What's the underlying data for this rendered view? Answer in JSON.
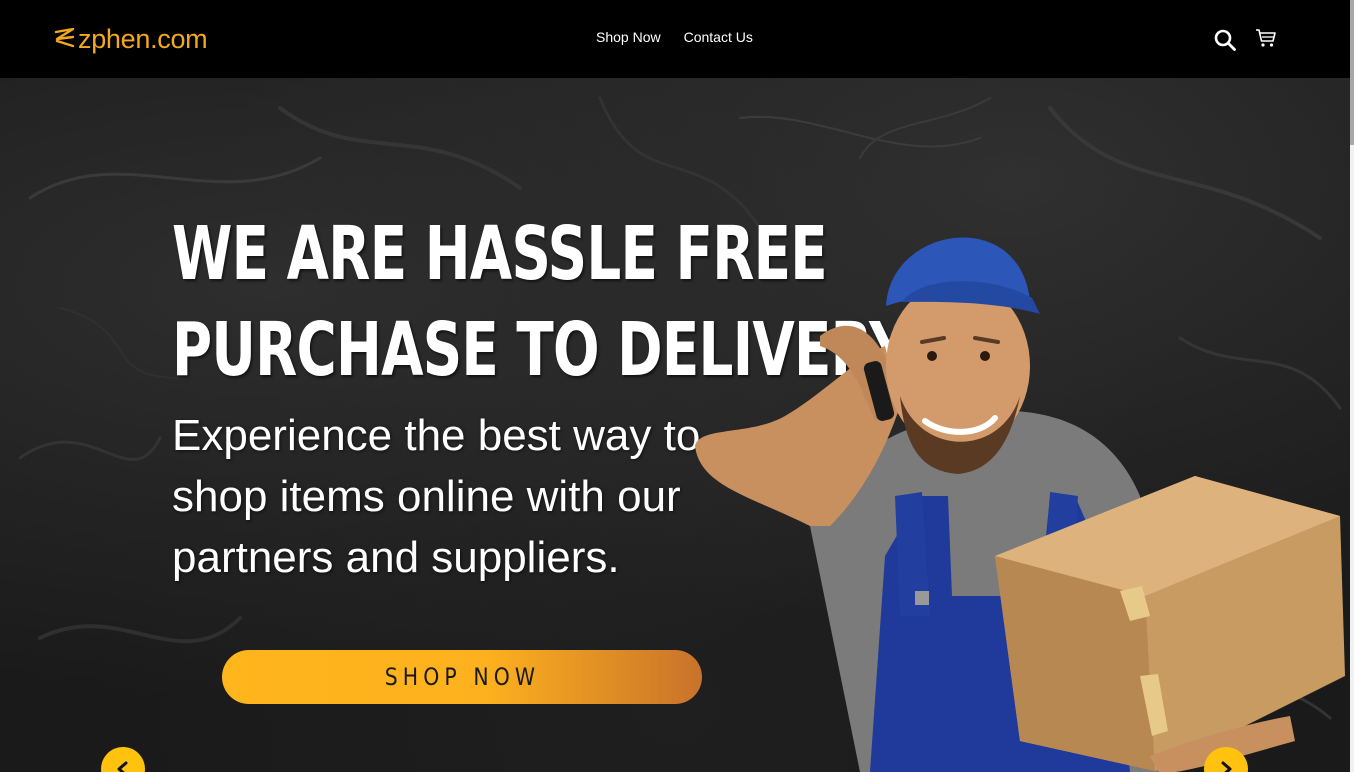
{
  "brand": {
    "name": "zphen.com",
    "color": "#f4a81d"
  },
  "nav": {
    "items": [
      {
        "label": "Shop Now"
      },
      {
        "label": "Contact Us"
      }
    ]
  },
  "header_icons": {
    "search": "search-icon",
    "cart": "cart-icon"
  },
  "hero": {
    "headline_line1": "WE ARE HASSLE FREE",
    "headline_line2": "PURCHASE TO DELIVERY",
    "subtext": "Experience the best way to shop items online with our partners and suppliers.",
    "cta_label": "SHOP NOW",
    "cta_color": "#ffb51c",
    "image": "delivery-man-with-phone-and-box",
    "arrow_color": "#ffc20e",
    "prev_icon": "chevron-left-icon",
    "next_icon": "chevron-right-icon"
  }
}
